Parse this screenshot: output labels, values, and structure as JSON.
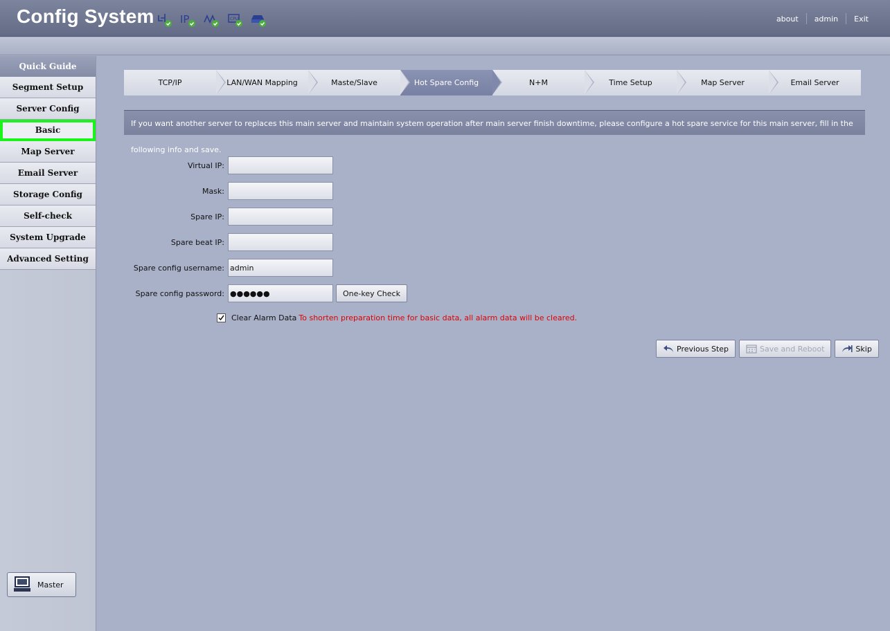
{
  "header": {
    "title": "Config System",
    "status_icons": [
      "network-check-icon",
      "ip-check-icon",
      "signal-check-icon",
      "cpu-check-icon",
      "disk-check-icon"
    ],
    "links": [
      "about",
      "admin",
      "Exit"
    ]
  },
  "sidebar": {
    "header": "Quick Guide",
    "items": [
      {
        "label": "Segment Setup"
      },
      {
        "label": "Server Config"
      },
      {
        "label": "Basic",
        "active": true
      },
      {
        "label": "Map Server"
      },
      {
        "label": "Email Server"
      },
      {
        "label": "Storage Config"
      },
      {
        "label": "Self-check"
      },
      {
        "label": "System Upgrade"
      },
      {
        "label": "Advanced Setting"
      }
    ],
    "master_label": "Master"
  },
  "steps": [
    {
      "label": "TCP/IP"
    },
    {
      "label": "LAN/WAN Mapping"
    },
    {
      "label": "Maste/Slave"
    },
    {
      "label": "Hot Spare Config",
      "active": true
    },
    {
      "label": "N+M"
    },
    {
      "label": "Time Setup"
    },
    {
      "label": "Map Server"
    },
    {
      "label": "Email Server"
    }
  ],
  "info_text": "If you want another server to replaces this main server and maintain system operation after main server finish downtime, please configure a hot spare service for this main server, fill in the following info and save.",
  "form": {
    "virtual_ip_label": "Virtual IP:",
    "virtual_ip_value": "",
    "mask_label": "Mask:",
    "mask_value": "",
    "spare_ip_label": "Spare IP:",
    "spare_ip_value": "",
    "spare_beat_ip_label": "Spare beat IP:",
    "spare_beat_ip_value": "",
    "username_label": "Spare config username:",
    "username_value": "admin",
    "password_label": "Spare config password:",
    "password_value": "●●●●●●",
    "one_key_check": "One-key Check",
    "clear_alarm_label": "Clear Alarm Data",
    "clear_alarm_checked": true,
    "clear_alarm_warning": "To shorten preparation time for basic data, all alarm data will be cleared."
  },
  "actions": {
    "previous": "Previous Step",
    "save": "Save and Reboot",
    "skip": "Skip"
  },
  "colors": {
    "active_outline": "#1af41a",
    "warning_text": "#e00000",
    "active_step": "#8089ab"
  }
}
